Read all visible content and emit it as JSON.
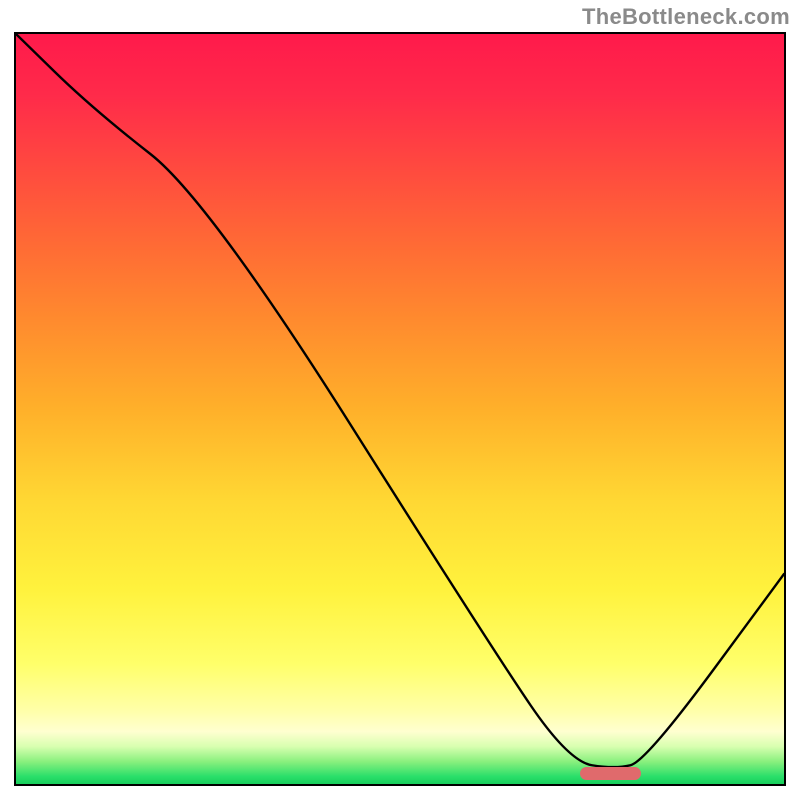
{
  "watermark": "TheBottleneck.com",
  "chart_data": {
    "type": "line",
    "title": "",
    "xlabel": "",
    "ylabel": "",
    "xlim": [
      0,
      100
    ],
    "ylim": [
      0,
      100
    ],
    "x": [
      0,
      10,
      25,
      62,
      72,
      78,
      82,
      100
    ],
    "y": [
      100,
      90,
      78,
      18,
      3,
      2,
      3,
      28
    ],
    "series": [
      {
        "name": "bottleneck-curve",
        "x": [
          0,
          10,
          25,
          62,
          72,
          78,
          82,
          100
        ],
        "y": [
          100,
          90,
          78,
          18,
          3,
          2,
          3,
          28
        ]
      }
    ],
    "optimum_marker": {
      "x_start": 73,
      "x_end": 81,
      "y": 2
    }
  }
}
